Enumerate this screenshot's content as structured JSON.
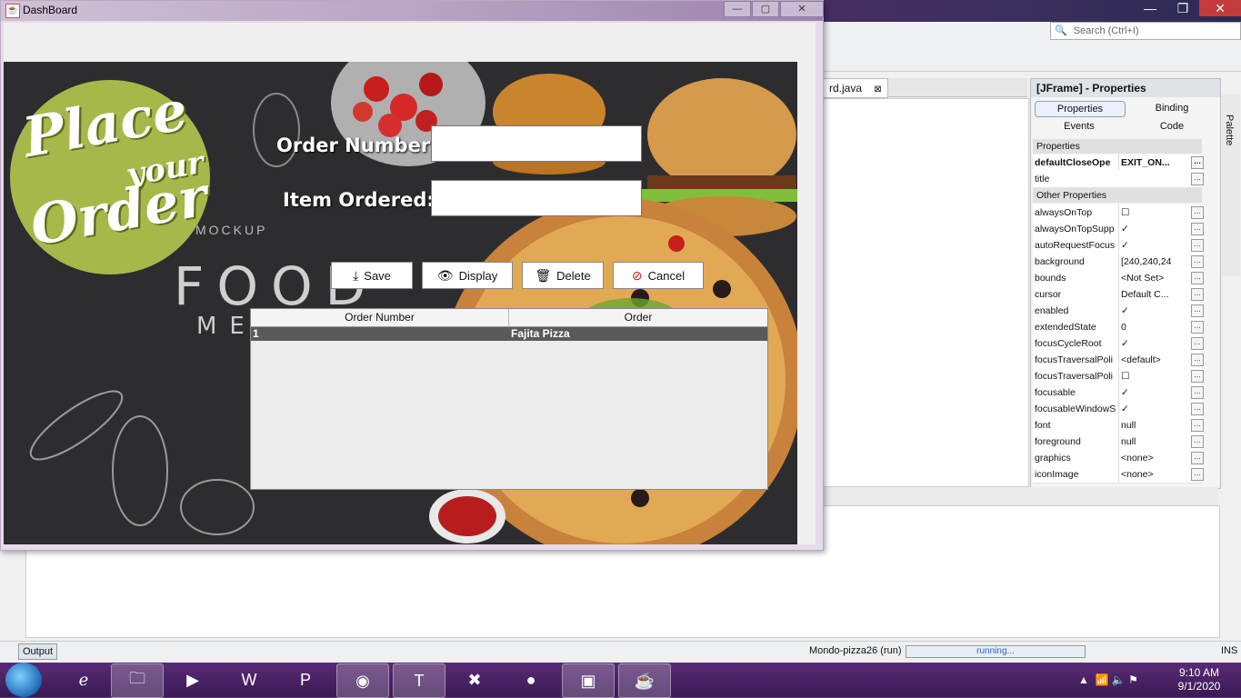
{
  "ide": {
    "search_placeholder": "Search (Ctrl+I)",
    "editor_tab": "rd.java",
    "properties_title": "[JFrame] - Properties",
    "props_tabs": [
      "Properties",
      "Binding",
      "Events",
      "Code"
    ],
    "palette": "Palette",
    "sections": {
      "properties": "Properties",
      "other": "Other Properties"
    },
    "props": [
      {
        "name": "defaultCloseOpe",
        "value": "EXIT_ON..."
      },
      {
        "name": "title",
        "value": ""
      }
    ],
    "other_props": [
      {
        "name": "alwaysOnTop",
        "value": "☐"
      },
      {
        "name": "alwaysOnTopSupp",
        "value": "✓"
      },
      {
        "name": "autoRequestFocus",
        "value": "✓"
      },
      {
        "name": "background",
        "value": "[240,240,24"
      },
      {
        "name": "bounds",
        "value": "<Not Set>"
      },
      {
        "name": "cursor",
        "value": "Default C..."
      },
      {
        "name": "enabled",
        "value": "✓"
      },
      {
        "name": "extendedState",
        "value": "0"
      },
      {
        "name": "focusCycleRoot",
        "value": "✓"
      },
      {
        "name": "focusTraversalPoli",
        "value": "<default>"
      },
      {
        "name": "focusTraversalPoli",
        "value": "☐"
      },
      {
        "name": "focusable",
        "value": "✓"
      },
      {
        "name": "focusableWindowS",
        "value": "✓"
      },
      {
        "name": "font",
        "value": "null"
      },
      {
        "name": "foreground",
        "value": "null"
      },
      {
        "name": "graphics",
        "value": "<none>"
      },
      {
        "name": "iconImage",
        "value": "<none>"
      }
    ],
    "output_tab": "Output",
    "run_label": "Mondo-pizza26 (run)",
    "progress_text": "running...",
    "ins": "INS"
  },
  "taskbar": {
    "time": "9:10 AM",
    "date": "9/1/2020"
  },
  "dashboard": {
    "title": "DashBoard",
    "badge": {
      "line1": "Place",
      "line2": "your",
      "line3": "Order"
    },
    "background_text": {
      "mockup": "MOCKUP",
      "food": "FOOD",
      "menu": "MENU"
    },
    "order_number_label": "Order Number:",
    "item_ordered_label": "Item Ordered:",
    "order_number_value": "",
    "item_ordered_value": "",
    "buttons": {
      "save": "Save",
      "display": "Display",
      "delete": "Delete",
      "cancel": "Cancel"
    },
    "table": {
      "columns": [
        "Order Number",
        "Order"
      ],
      "rows": [
        [
          "1",
          "Fajita Pizza"
        ]
      ]
    }
  }
}
